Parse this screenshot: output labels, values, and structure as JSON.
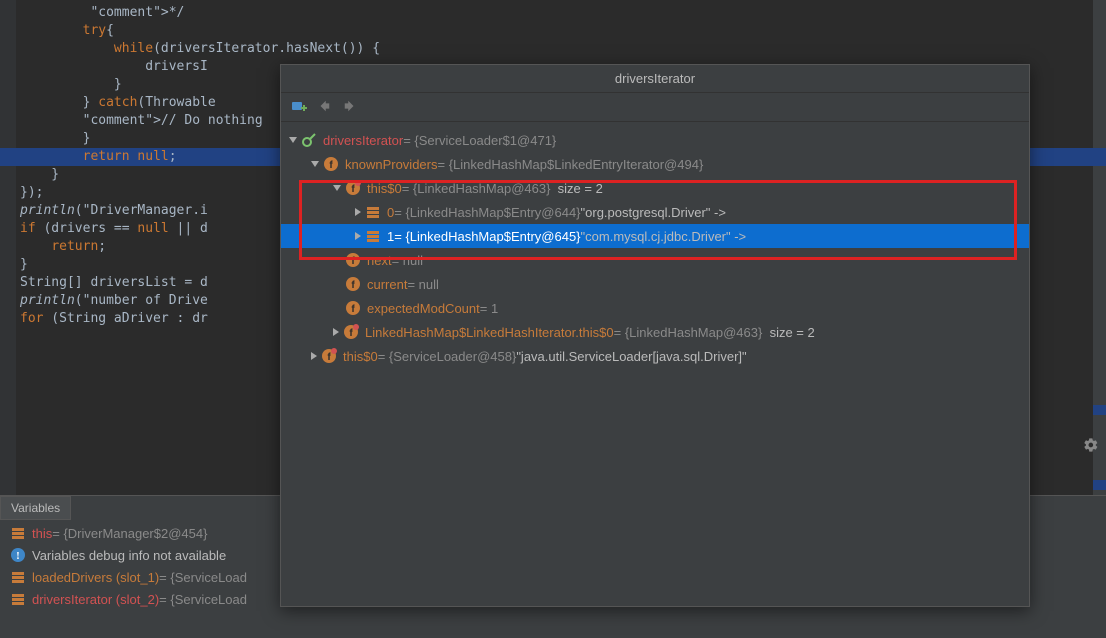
{
  "editor": {
    "lines": [
      "         */",
      "        try{",
      "            while(driversIterator.hasNext()) {",
      "                driversI",
      "            }",
      "        } catch(Throwable",
      "        // Do nothing",
      "        }",
      "        return null;",
      "    }",
      "});",
      "",
      "println(\"DriverManager.i",
      "",
      "if (drivers == null || d",
      "    return;",
      "}",
      "String[] driversList = d",
      "println(\"number of Drive",
      "for (String aDriver : dr"
    ]
  },
  "popup": {
    "title": "driversIterator",
    "rows": [
      {
        "indent": 0,
        "arrow": "down",
        "icon": "watch",
        "label": "driversIterator",
        "labelClass": "red",
        "value": "= {ServiceLoader$1@471}"
      },
      {
        "indent": 1,
        "arrow": "down",
        "icon": "field",
        "label": "knownProviders",
        "labelClass": "lbl",
        "value": "= {LinkedHashMap$LinkedEntryIterator@494}"
      },
      {
        "indent": 2,
        "arrow": "down",
        "icon": "fieldp",
        "label": "this$0",
        "labelClass": "lbl",
        "value": "= {LinkedHashMap@463}",
        "extra": "size = 2"
      },
      {
        "indent": 3,
        "arrow": "right",
        "icon": "entry",
        "label": "0",
        "labelClass": "",
        "value": "= {LinkedHashMap$Entry@644}",
        "strval": "\"org.postgresql.Driver\" ->"
      },
      {
        "indent": 3,
        "arrow": "right",
        "icon": "entry",
        "label": "1",
        "labelClass": "",
        "value": "= {LinkedHashMap$Entry@645}",
        "strval": "\"com.mysql.cj.jdbc.Driver\" ->",
        "selected": true
      },
      {
        "indent": 2,
        "arrow": "none",
        "icon": "field",
        "label": "next",
        "labelClass": "lbl",
        "value": "= null"
      },
      {
        "indent": 2,
        "arrow": "none",
        "icon": "field",
        "label": "current",
        "labelClass": "lbl",
        "value": "= null"
      },
      {
        "indent": 2,
        "arrow": "none",
        "icon": "field",
        "label": "expectedModCount",
        "labelClass": "lbl",
        "value": "= 1"
      },
      {
        "indent": 2,
        "arrow": "right",
        "icon": "fieldp",
        "label": "LinkedHashMap$LinkedHashIterator.this$0",
        "labelClass": "lbl",
        "value": "= {LinkedHashMap@463}",
        "extra": "size = 2"
      },
      {
        "indent": 1,
        "arrow": "right",
        "icon": "fieldp",
        "label": "this$0",
        "labelClass": "lbl",
        "value": "= {ServiceLoader@458}",
        "strval": "\"java.util.ServiceLoader[java.sql.Driver]\""
      }
    ]
  },
  "variables": {
    "title": "Variables",
    "rows": [
      {
        "icon": "entry",
        "label": "this",
        "labelClass": "red",
        "value": "= {DriverManager$2@454}"
      },
      {
        "icon": "info",
        "text": "Variables debug info not available"
      },
      {
        "icon": "entry",
        "label": "loadedDrivers (slot_1)",
        "labelClass": "lbl",
        "value": "= {ServiceLoad"
      },
      {
        "icon": "entry",
        "label": "driversIterator (slot_2)",
        "labelClass": "red",
        "value": "= {ServiceLoad"
      }
    ]
  }
}
